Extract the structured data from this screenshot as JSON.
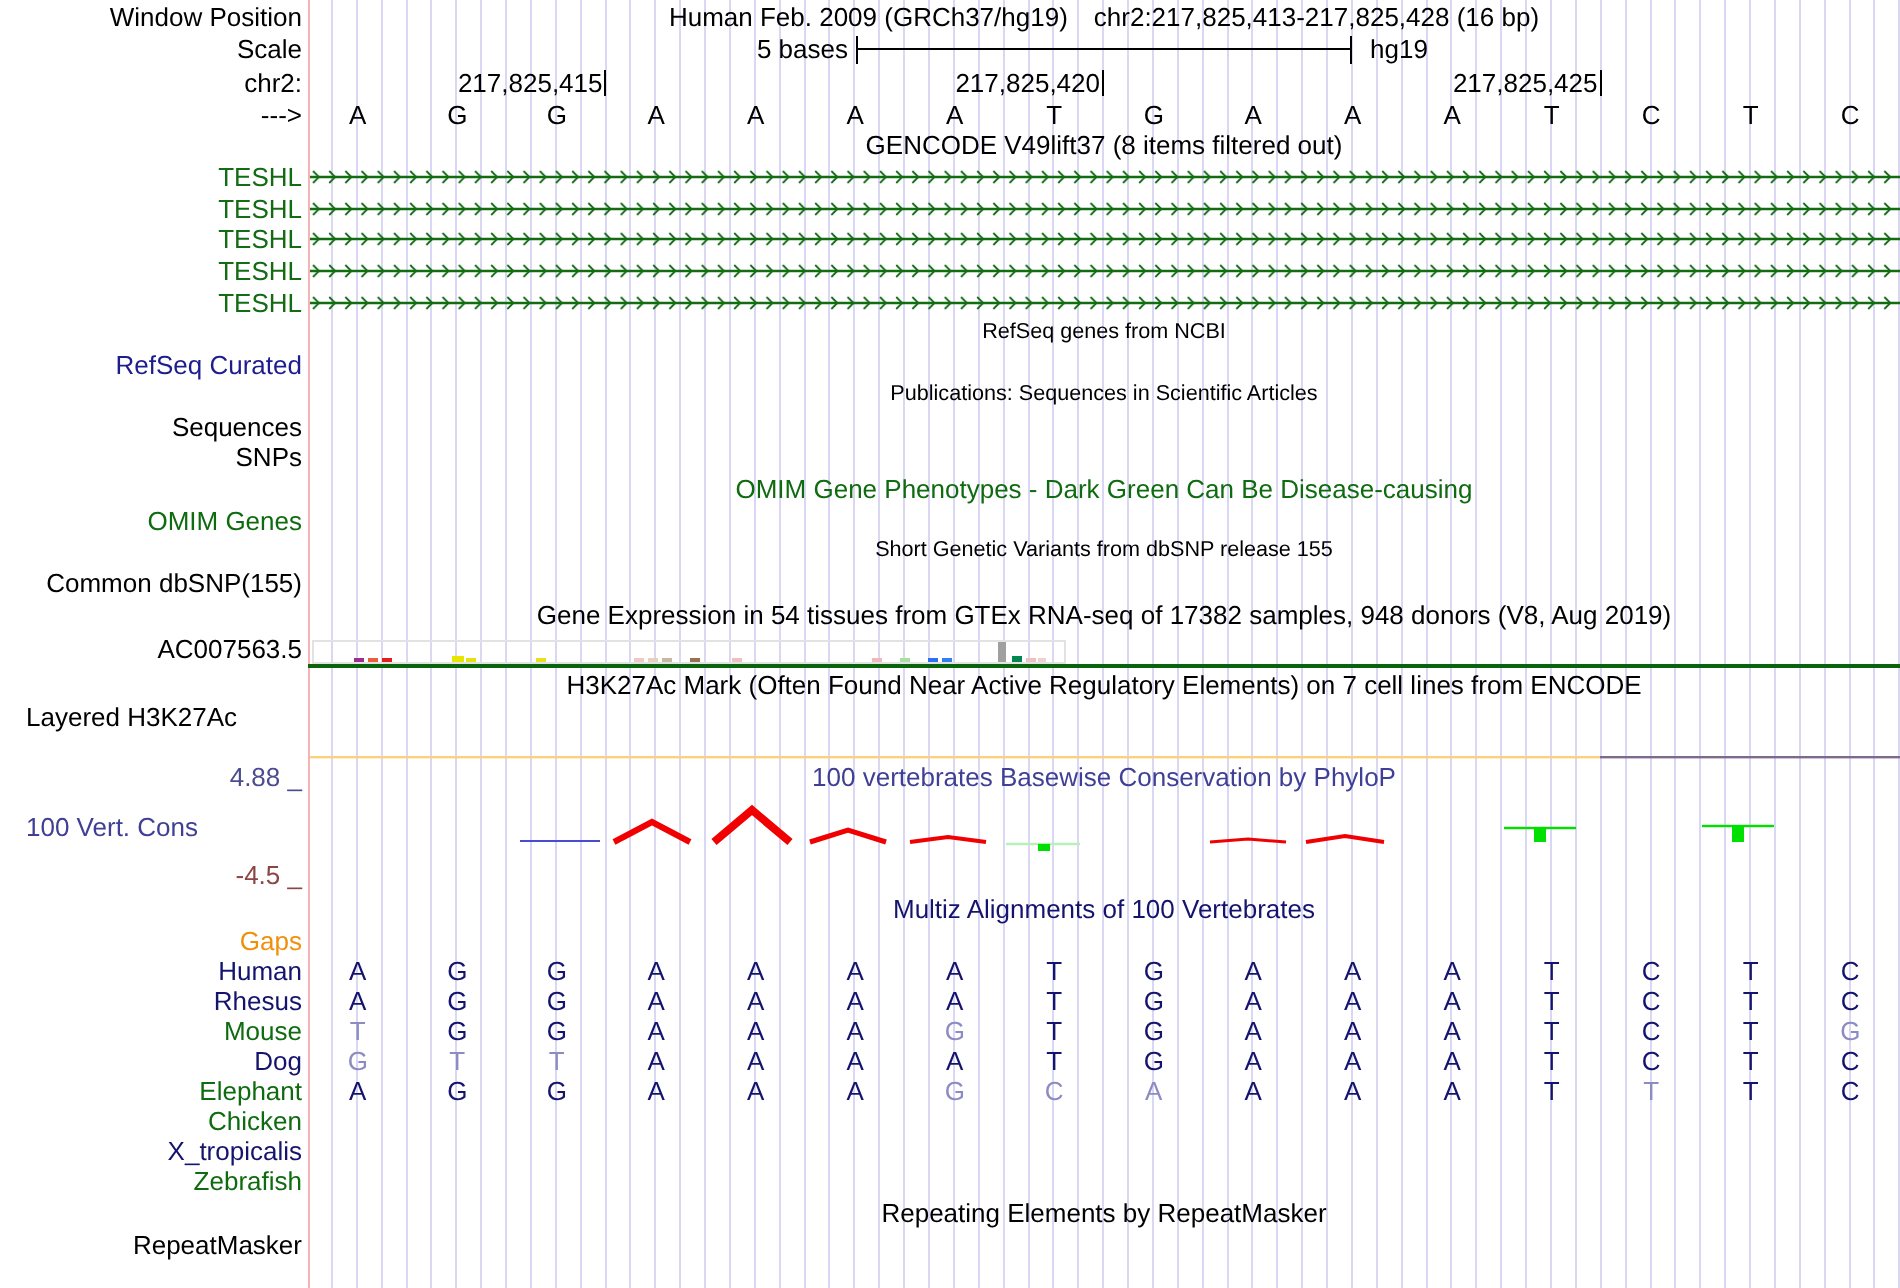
{
  "ruler": {
    "window_label": "Window Position",
    "assembly": "Human Feb. 2009 (GRCh37/hg19)",
    "position": "chr2:217,825,413-217,825,428 (16 bp)",
    "scale_label": "Scale",
    "scale_text": "5 bases",
    "scale_assembly": "hg19",
    "chrom_label": "chr2:",
    "strand_label": "--->",
    "bases": [
      {
        "base": "A"
      },
      {
        "base": "G"
      },
      {
        "base": "G",
        "tick": "217,825,415"
      },
      {
        "base": "A"
      },
      {
        "base": "A"
      },
      {
        "base": "A"
      },
      {
        "base": "A"
      },
      {
        "base": "T",
        "tick": "217,825,420"
      },
      {
        "base": "G"
      },
      {
        "base": "A"
      },
      {
        "base": "A"
      },
      {
        "base": "A"
      },
      {
        "base": "T",
        "tick": "217,825,425"
      },
      {
        "base": "C"
      },
      {
        "base": "T"
      },
      {
        "base": "C"
      }
    ]
  },
  "tracks": [
    {
      "kind": "title",
      "text": "GENCODE V49lift37 (8 items filtered out)",
      "color": "#000000"
    },
    {
      "kind": "gene",
      "name": "TESHL",
      "forward": true,
      "color": "#136c13"
    },
    {
      "kind": "gene",
      "name": "TESHL",
      "forward": true,
      "color": "#136c13"
    },
    {
      "kind": "gene",
      "name": "TESHL",
      "forward": true,
      "color": "#136c13"
    },
    {
      "kind": "gene",
      "name": "TESHL",
      "forward": true,
      "color": "#136c13"
    },
    {
      "kind": "gene",
      "name": "TESHL",
      "forward": true,
      "color": "#136c13"
    },
    {
      "kind": "caption",
      "text": "RefSeq genes from NCBI"
    },
    {
      "kind": "label",
      "text": "RefSeq Curated",
      "color": "#1d1d8e"
    },
    {
      "kind": "caption",
      "text": "Publications: Sequences in Scientific Articles"
    },
    {
      "kind": "label",
      "text": "Sequences",
      "color": "#000000"
    },
    {
      "kind": "label",
      "text": "SNPs",
      "color": "#000000"
    },
    {
      "kind": "title",
      "text": "OMIM Gene Phenotypes - Dark Green Can Be Disease-causing",
      "color": "#0f6b0f"
    },
    {
      "kind": "label",
      "text": "OMIM Genes",
      "color": "#0f6b0f"
    },
    {
      "kind": "caption",
      "text": "Short Genetic Variants from dbSNP release 155"
    },
    {
      "kind": "label",
      "text": "Common dbSNP(155)",
      "color": "#000000"
    },
    {
      "kind": "title",
      "text": "Gene Expression in 54 tissues from GTEx RNA-seq of 17382 samples, 948 donors (V8, Aug 2019)",
      "color": "#000000"
    },
    {
      "kind": "expression",
      "label": "AC007563.5"
    },
    {
      "kind": "title",
      "text": "H3K27Ac Mark (Often Found Near Active Regulatory Elements) on 7 cell lines from ENCODE",
      "color": "#000000"
    },
    {
      "kind": "signal",
      "label": "Layered H3K27Ac"
    },
    {
      "kind": "conservation",
      "title": "100 vertebrates Basewise Conservation by PhyloP",
      "label": "100 Vert. Cons",
      "max": "4.88 _",
      "min": "-4.5 _"
    },
    {
      "kind": "title",
      "text": "Multiz Alignments of 100 Vertebrates",
      "color": "#14146e"
    },
    {
      "kind": "label",
      "text": "Gaps",
      "color": "#f0900a"
    },
    {
      "kind": "species",
      "name": "Human",
      "color": "#14146e",
      "bases": [
        {
          "base": "A",
          "match": true
        },
        {
          "base": "G",
          "match": true
        },
        {
          "base": "G",
          "match": true
        },
        {
          "base": "A",
          "match": true
        },
        {
          "base": "A",
          "match": true
        },
        {
          "base": "A",
          "match": true
        },
        {
          "base": "A",
          "match": true
        },
        {
          "base": "T",
          "match": true
        },
        {
          "base": "G",
          "match": true
        },
        {
          "base": "A",
          "match": true
        },
        {
          "base": "A",
          "match": true
        },
        {
          "base": "A",
          "match": true
        },
        {
          "base": "T",
          "match": true
        },
        {
          "base": "C",
          "match": true
        },
        {
          "base": "T",
          "match": true
        },
        {
          "base": "C",
          "match": true
        }
      ]
    },
    {
      "kind": "species",
      "name": "Rhesus",
      "color": "#14146e",
      "bases": [
        {
          "base": "A",
          "match": true
        },
        {
          "base": "G",
          "match": true
        },
        {
          "base": "G",
          "match": true
        },
        {
          "base": "A",
          "match": true
        },
        {
          "base": "A",
          "match": true
        },
        {
          "base": "A",
          "match": true
        },
        {
          "base": "A",
          "match": true
        },
        {
          "base": "T",
          "match": true
        },
        {
          "base": "G",
          "match": true
        },
        {
          "base": "A",
          "match": true
        },
        {
          "base": "A",
          "match": true
        },
        {
          "base": "A",
          "match": true
        },
        {
          "base": "T",
          "match": true
        },
        {
          "base": "C",
          "match": true
        },
        {
          "base": "T",
          "match": true
        },
        {
          "base": "C",
          "match": true
        }
      ]
    },
    {
      "kind": "species",
      "name": "Mouse",
      "color": "#0f6b0f",
      "bases": [
        {
          "base": "T",
          "match": false
        },
        {
          "base": "G",
          "match": true
        },
        {
          "base": "G",
          "match": true
        },
        {
          "base": "A",
          "match": true
        },
        {
          "base": "A",
          "match": true
        },
        {
          "base": "A",
          "match": true
        },
        {
          "base": "G",
          "match": false
        },
        {
          "base": "T",
          "match": true
        },
        {
          "base": "G",
          "match": true
        },
        {
          "base": "A",
          "match": true
        },
        {
          "base": "A",
          "match": true
        },
        {
          "base": "A",
          "match": true
        },
        {
          "base": "T",
          "match": true
        },
        {
          "base": "C",
          "match": true
        },
        {
          "base": "T",
          "match": true
        },
        {
          "base": "G",
          "match": false
        }
      ]
    },
    {
      "kind": "species",
      "name": "Dog",
      "color": "#14146e",
      "bases": [
        {
          "base": "G",
          "match": false
        },
        {
          "base": "T",
          "match": false
        },
        {
          "base": "T",
          "match": false
        },
        {
          "base": "A",
          "match": true
        },
        {
          "base": "A",
          "match": true
        },
        {
          "base": "A",
          "match": true
        },
        {
          "base": "A",
          "match": true
        },
        {
          "base": "T",
          "match": true
        },
        {
          "base": "G",
          "match": true
        },
        {
          "base": "A",
          "match": true
        },
        {
          "base": "A",
          "match": true
        },
        {
          "base": "A",
          "match": true
        },
        {
          "base": "T",
          "match": true
        },
        {
          "base": "C",
          "match": true
        },
        {
          "base": "T",
          "match": true
        },
        {
          "base": "C",
          "match": true
        }
      ]
    },
    {
      "kind": "species",
      "name": "Elephant",
      "color": "#0f6b0f",
      "bases": [
        {
          "base": "A",
          "match": true
        },
        {
          "base": "G",
          "match": true
        },
        {
          "base": "G",
          "match": true
        },
        {
          "base": "A",
          "match": true
        },
        {
          "base": "A",
          "match": true
        },
        {
          "base": "A",
          "match": true
        },
        {
          "base": "G",
          "match": false
        },
        {
          "base": "C",
          "match": false
        },
        {
          "base": "A",
          "match": false
        },
        {
          "base": "A",
          "match": true
        },
        {
          "base": "A",
          "match": true
        },
        {
          "base": "A",
          "match": true
        },
        {
          "base": "T",
          "match": true
        },
        {
          "base": "T",
          "match": false
        },
        {
          "base": "T",
          "match": true
        },
        {
          "base": "C",
          "match": true
        }
      ]
    },
    {
      "kind": "species",
      "name": "Chicken",
      "color": "#0f6b0f"
    },
    {
      "kind": "species",
      "name": "X_tropicalis",
      "color": "#14146e"
    },
    {
      "kind": "species",
      "name": "Zebrafish",
      "color": "#0f6b0f"
    },
    {
      "kind": "title",
      "text": "Repeating Elements by RepeatMasker",
      "color": "#000000"
    },
    {
      "kind": "label",
      "text": "RepeatMasker",
      "color": "#000000"
    }
  ]
}
